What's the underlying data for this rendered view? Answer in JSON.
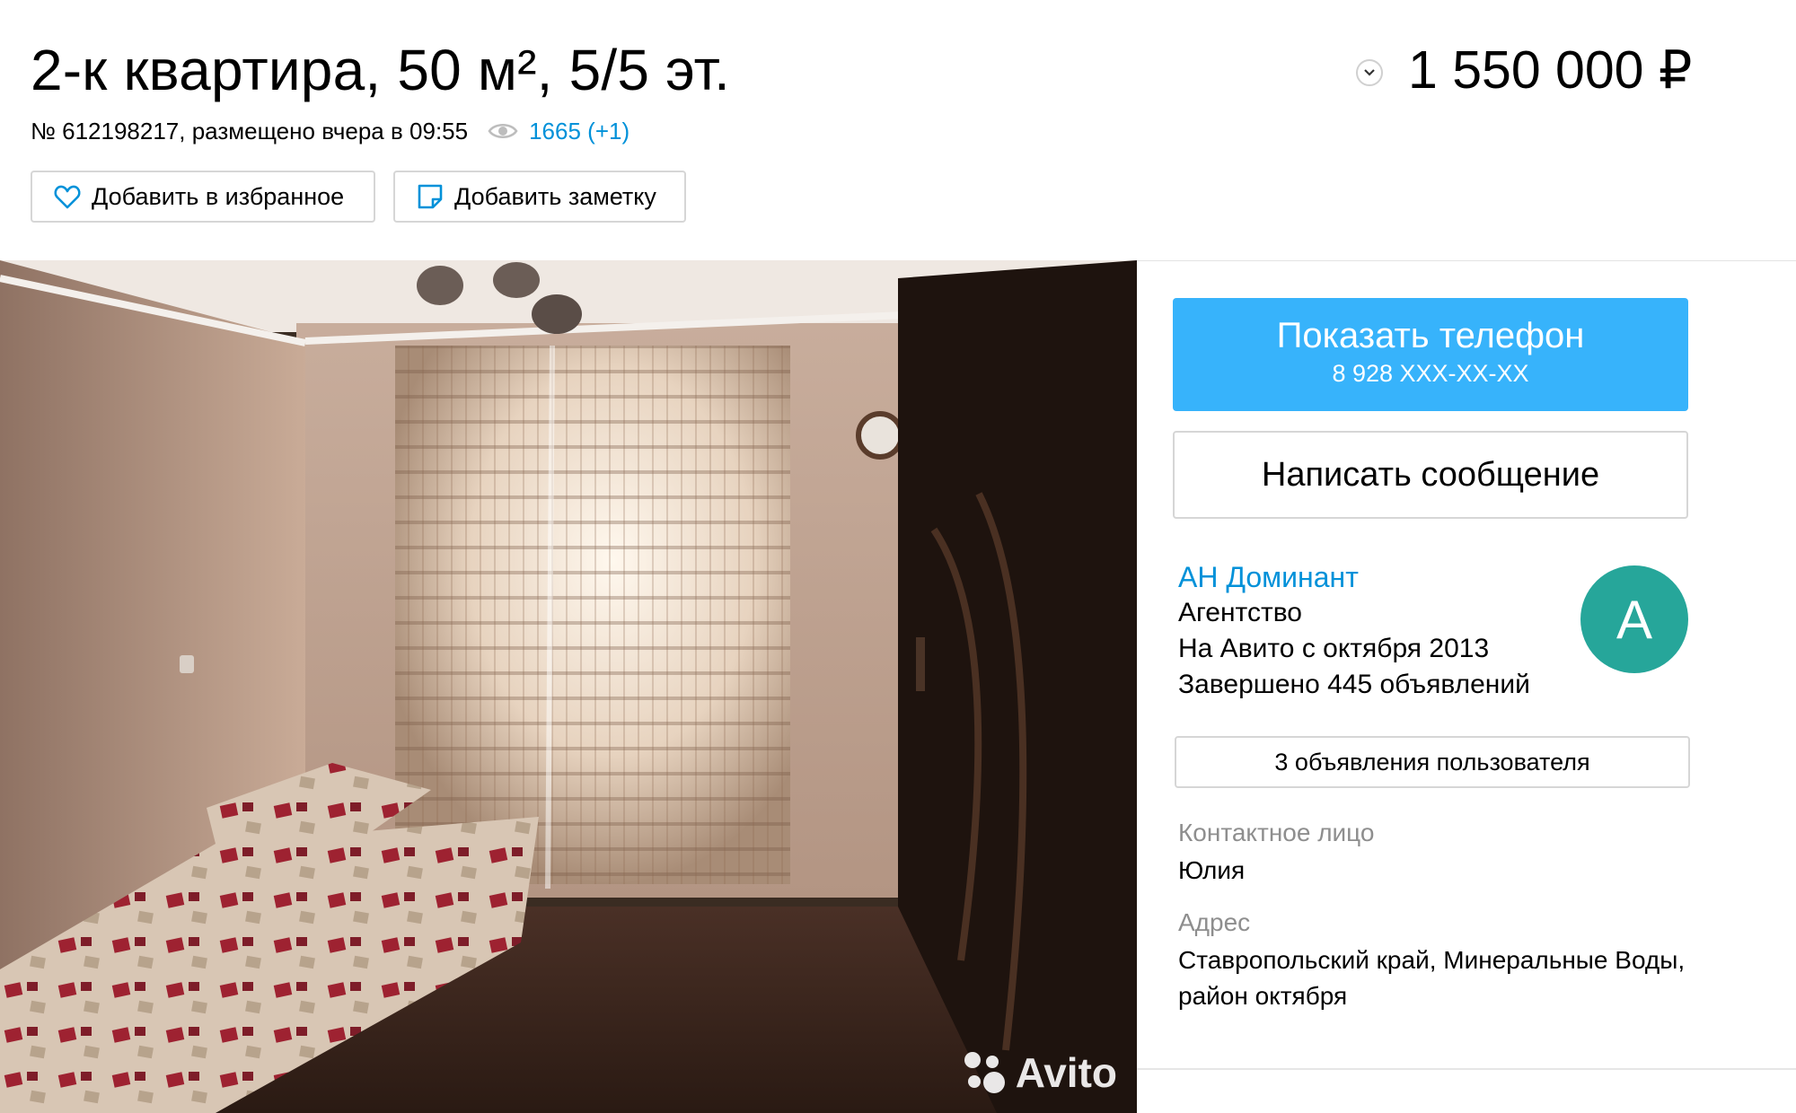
{
  "listing": {
    "title": "2-к квартира, 50 м², 5/5 эт.",
    "price": "1 550 000 ₽",
    "meta_text": "№ 612198217, размещено вчера в 09:55",
    "views": "1665 (+1)"
  },
  "actions": {
    "favorite_label": "Добавить в избранное",
    "note_label": "Добавить заметку"
  },
  "photo": {
    "watermark": "Avito"
  },
  "contact": {
    "phone_button_label": "Показать телефон",
    "phone_masked": "8 928 XXX-XX-XX",
    "message_button_label": "Написать сообщение"
  },
  "seller": {
    "name": "АН Доминант",
    "type": "Агентство",
    "since": "На Авито с октября 2013",
    "completed": "Завершено 445 объявлений",
    "avatar_letter": "А",
    "user_ads_label": "3 объявления пользователя"
  },
  "details": {
    "contact_person_label": "Контактное лицо",
    "contact_person": "Юлия",
    "address_label": "Адрес",
    "address_line1": "Ставропольский край, Минеральные Воды,",
    "address_line2": "район октября"
  },
  "colors": {
    "accent_blue": "#37b3fb",
    "link_blue": "#0091d9",
    "avatar_green": "#26a69a"
  }
}
